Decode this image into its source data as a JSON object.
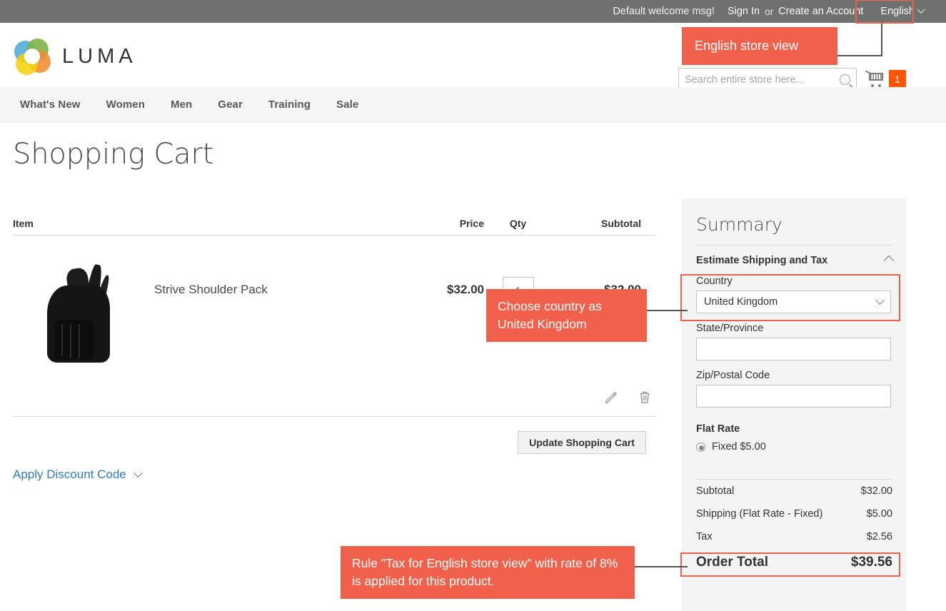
{
  "topbar": {
    "welcome": "Default welcome msg!",
    "sign_in": "Sign In",
    "or": "or",
    "create_account": "Create an Account",
    "language": "English"
  },
  "header": {
    "logo_text": "LUMA",
    "search_placeholder": "Search entire store here...",
    "cart_count": "1"
  },
  "nav": {
    "items": [
      {
        "label": "What's New"
      },
      {
        "label": "Women"
      },
      {
        "label": "Men"
      },
      {
        "label": "Gear"
      },
      {
        "label": "Training"
      },
      {
        "label": "Sale"
      }
    ]
  },
  "page": {
    "title": "Shopping Cart"
  },
  "cart": {
    "columns": {
      "item": "Item",
      "price": "Price",
      "qty": "Qty",
      "subtotal": "Subtotal"
    },
    "rows": [
      {
        "name": "Strive Shoulder Pack",
        "price": "$32.00",
        "qty": "1",
        "subtotal": "$32.00"
      }
    ],
    "update_button": "Update Shopping Cart",
    "discount_link": "Apply Discount Code"
  },
  "summary": {
    "title": "Summary",
    "estimate_section": "Estimate Shipping and Tax",
    "country_label": "Country",
    "country_value": "United Kingdom",
    "state_label": "State/Province",
    "state_value": "",
    "zip_label": "Zip/Postal Code",
    "zip_value": "",
    "flat_rate_label": "Flat Rate",
    "flat_rate_option": "Fixed $5.00",
    "totals": [
      {
        "label": "Subtotal",
        "value": "$32.00"
      },
      {
        "label": "Shipping (Flat Rate - Fixed)",
        "value": "$5.00"
      },
      {
        "label": "Tax",
        "value": "$2.56"
      }
    ],
    "order_total_label": "Order Total",
    "order_total_value": "$39.56"
  },
  "annotations": {
    "english_store_view": "English store view",
    "choose_country": "Choose country as United Kingdom",
    "tax_rule": "Rule \"Tax for English store view\" with rate of 8% is applied for this product."
  },
  "colors": {
    "annotation": "#f0604a",
    "topbar": "#6e716e",
    "cart_badge": "#ff5501",
    "link": "#2f7dbd"
  }
}
